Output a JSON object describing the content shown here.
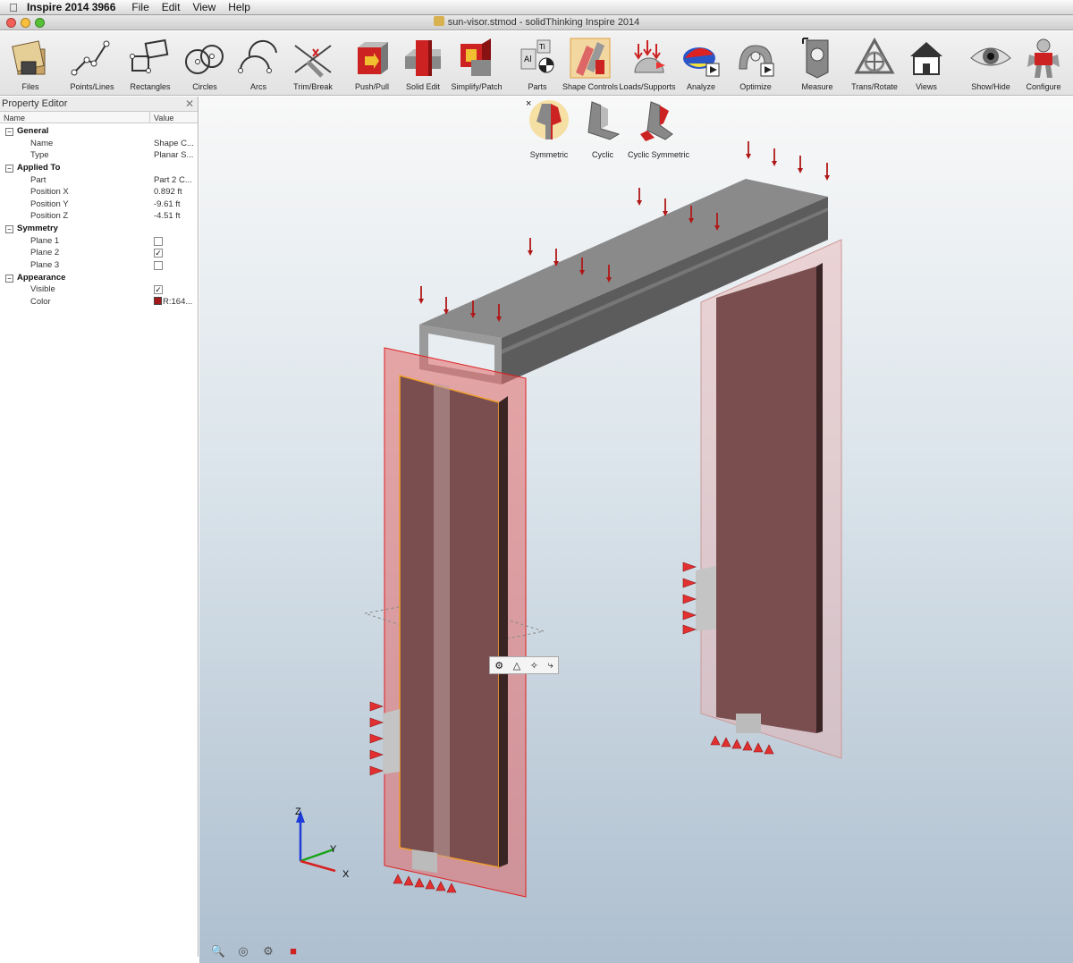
{
  "menubar": {
    "app_name": "Inspire 2014 3966",
    "menus": [
      "File",
      "Edit",
      "View",
      "Help"
    ]
  },
  "window": {
    "title": "sun-visor.stmod - solidThinking Inspire 2014"
  },
  "toolbar": {
    "tools": [
      {
        "label": "Files",
        "icon": "files-icon"
      },
      {
        "label": "Points/Lines",
        "icon": "points-lines-icon"
      },
      {
        "label": "Rectangles",
        "icon": "rectangles-icon"
      },
      {
        "label": "Circles",
        "icon": "circles-icon"
      },
      {
        "label": "Arcs",
        "icon": "arcs-icon"
      },
      {
        "label": "Trim/Break",
        "icon": "trim-break-icon"
      },
      {
        "label": "Push/Pull",
        "icon": "push-pull-icon"
      },
      {
        "label": "Solid Edit",
        "icon": "solid-edit-icon"
      },
      {
        "label": "Simplify/Patch",
        "icon": "simplify-patch-icon"
      },
      {
        "label": "Parts",
        "icon": "parts-icon"
      },
      {
        "label": "Shape Controls",
        "icon": "shape-controls-icon"
      },
      {
        "label": "Loads/Supports",
        "icon": "loads-supports-icon"
      },
      {
        "label": "Analyze",
        "icon": "analyze-icon"
      },
      {
        "label": "Optimize",
        "icon": "optimize-icon"
      },
      {
        "label": "Measure",
        "icon": "measure-icon"
      },
      {
        "label": "Trans/Rotate",
        "icon": "trans-rotate-icon"
      },
      {
        "label": "Views",
        "icon": "views-icon"
      },
      {
        "label": "Show/Hide",
        "icon": "show-hide-icon"
      },
      {
        "label": "Configure",
        "icon": "configure-icon"
      }
    ]
  },
  "subtoolbar": {
    "close": "×",
    "tools": [
      {
        "label": "Symmetric",
        "icon": "symmetric-icon"
      },
      {
        "label": "Cyclic",
        "icon": "cyclic-icon"
      },
      {
        "label": "Cyclic Symmetric",
        "icon": "cyclic-symmetric-icon"
      }
    ]
  },
  "property_editor": {
    "title": "Property Editor",
    "close": "✕",
    "col_name": "Name",
    "col_value": "Value",
    "groups": {
      "general": {
        "label": "General",
        "name_label": "Name",
        "name_value": "Shape C...",
        "type_label": "Type",
        "type_value": "Planar S..."
      },
      "applied_to": {
        "label": "Applied To",
        "part_label": "Part",
        "part_value": "Part 2 C...",
        "px_label": "Position X",
        "px_value": "0.892 ft",
        "py_label": "Position Y",
        "py_value": "-9.61 ft",
        "pz_label": "Position Z",
        "pz_value": "-4.51 ft"
      },
      "symmetry": {
        "label": "Symmetry",
        "plane1_label": "Plane 1",
        "plane1_checked": false,
        "plane2_label": "Plane 2",
        "plane2_checked": true,
        "plane3_label": "Plane 3",
        "plane3_checked": false
      },
      "appearance": {
        "label": "Appearance",
        "visible_label": "Visible",
        "visible_checked": true,
        "color_label": "Color",
        "color_value": "R:164...",
        "color_hex": "#a4191c"
      }
    }
  },
  "viewport": {
    "axis_x": "X",
    "axis_y": "Y",
    "axis_z": "Z",
    "minibar_icons": [
      "symmetric-icon",
      "rotate-icon",
      "move-icon",
      "axis-icon"
    ],
    "bottom_icons": [
      "zoom-in-icon",
      "zoom-fit-icon",
      "camera-icon",
      "stop-icon"
    ]
  },
  "colors": {
    "load_arrow": "#b01818",
    "support": "#e23030",
    "panel_fill": "#7a4e4e",
    "beam": "#6b6b6b",
    "symmetry_plane": "#e46a6a"
  }
}
